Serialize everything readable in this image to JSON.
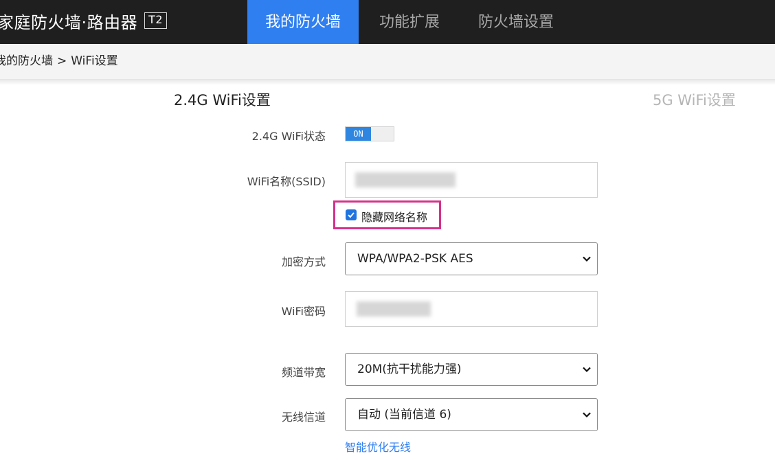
{
  "header": {
    "brand_title": "家庭防火墙·路由器",
    "brand_badge": "T2",
    "tabs": [
      {
        "label": "我的防火墙",
        "active": true
      },
      {
        "label": "功能扩展",
        "active": false
      },
      {
        "label": "防火墙设置",
        "active": false
      }
    ]
  },
  "breadcrumb": {
    "parent": "我的防火墙",
    "separator": ">",
    "current": "WiFi设置"
  },
  "wifi": {
    "section_title": "2.4G WiFi设置",
    "alt_section_tab": "5G WiFi设置",
    "status": {
      "label": "2.4G WiFi状态",
      "value": "ON"
    },
    "ssid": {
      "label": "WiFi名称(SSID)"
    },
    "hide_ssid": {
      "label": "隐藏网络名称",
      "checked": true
    },
    "encryption": {
      "label": "加密方式",
      "value": "WPA/WPA2-PSK AES"
    },
    "password": {
      "label": "WiFi密码"
    },
    "bandwidth": {
      "label": "频道带宽",
      "value": "20M(抗干扰能力强)"
    },
    "channel": {
      "label": "无线信道",
      "value": "自动 (当前信道 6)"
    },
    "optimize_link": "智能优化无线"
  },
  "colors": {
    "topbar": "#1f1f1f",
    "accent": "#2f7ff1",
    "highlight_box": "#d4318a"
  }
}
